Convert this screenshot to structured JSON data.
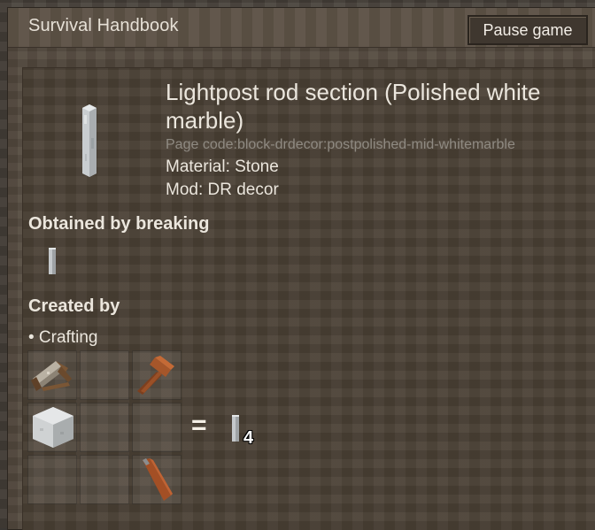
{
  "window": {
    "title": "Survival Handbook",
    "pause_label": "Pause game"
  },
  "item": {
    "name": "Lightpost rod section (Polished white marble)",
    "page_code": "Page code:block-drdecor:postpolished-mid-whitemarble",
    "material": "Material: Stone",
    "mod": "Mod: DR decor"
  },
  "sections": {
    "obtained": "Obtained by breaking",
    "created": "Created by",
    "crafting": "• Crafting"
  },
  "recipe": {
    "grid": [
      [
        "saw-icon",
        "",
        "hammer-icon"
      ],
      [
        "marble-block-icon",
        "",
        ""
      ],
      [
        "",
        "",
        "chisel-icon"
      ]
    ],
    "equals": "=",
    "output_icon": "rod-icon",
    "output_quantity": "4"
  }
}
